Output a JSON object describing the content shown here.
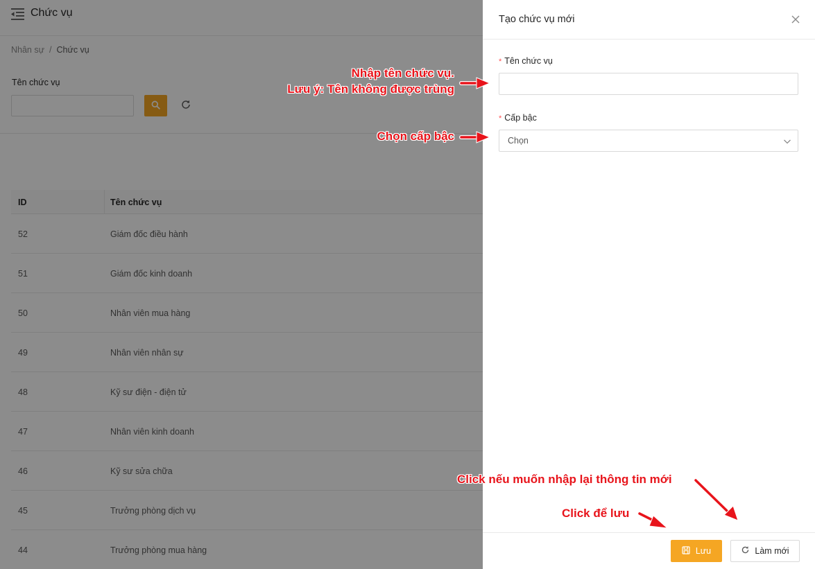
{
  "header": {
    "title": "Chức vụ",
    "menu_icon": "menu-fold-icon"
  },
  "breadcrumb": {
    "items": [
      "Nhân sự",
      "Chức vụ"
    ],
    "separator": "/"
  },
  "filter": {
    "label": "Tên chức vụ",
    "input_value": "",
    "search_icon": "search-icon",
    "reload_icon": "reload-icon"
  },
  "table": {
    "columns": [
      "ID",
      "Tên chức vụ"
    ],
    "rows": [
      {
        "id": "52",
        "name": "Giám đốc điều hành"
      },
      {
        "id": "51",
        "name": "Giám đốc kinh doanh"
      },
      {
        "id": "50",
        "name": "Nhân viên mua hàng"
      },
      {
        "id": "49",
        "name": "Nhân viên nhân sự"
      },
      {
        "id": "48",
        "name": "Kỹ sư điện - điện tử"
      },
      {
        "id": "47",
        "name": "Nhân viên kinh doanh"
      },
      {
        "id": "46",
        "name": "Kỹ sư sửa chữa"
      },
      {
        "id": "45",
        "name": "Trưởng phòng dịch vụ"
      },
      {
        "id": "44",
        "name": "Trưởng phòng mua hàng"
      }
    ]
  },
  "drawer": {
    "title": "Tạo chức vụ mới",
    "close_icon": "close-icon",
    "fields": {
      "name_label": "Tên chức vụ",
      "name_value": "",
      "level_label": "Cấp bậc",
      "level_value": "Chọn",
      "required_mark": "*"
    },
    "buttons": {
      "save": "Lưu",
      "reset": "Làm mới"
    }
  },
  "annotations": {
    "name_hint_line1": "Nhập tên chức vụ.",
    "name_hint_line2": "Lưu ý: Tên không được trùng",
    "level_hint": "Chọn cấp bậc",
    "reset_hint": "Click nếu muốn nhập lại thông tin mới",
    "save_hint": "Click để lưu"
  },
  "colors": {
    "accent": "#f5a623",
    "annotation": "#e8141b",
    "required": "#ff4d4f",
    "overlay": "rgba(0,0,0,0.45)"
  }
}
